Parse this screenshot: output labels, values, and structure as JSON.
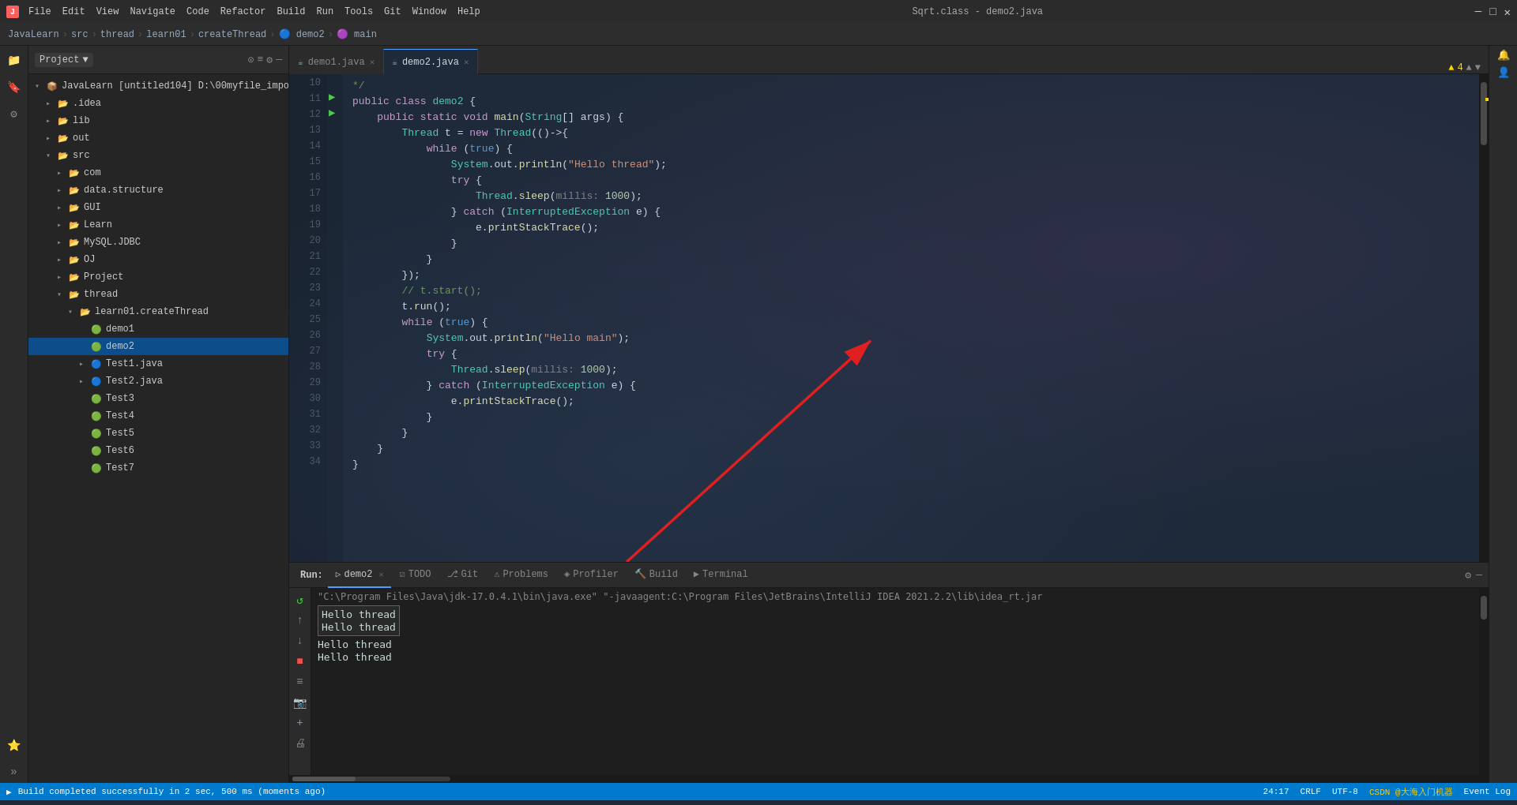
{
  "titlebar": {
    "app_icon": "J",
    "menu_items": [
      "File",
      "Edit",
      "View",
      "Navigate",
      "Code",
      "Refactor",
      "Build",
      "Run",
      "Tools",
      "Git",
      "Window",
      "Help"
    ],
    "title": "Sqrt.class - demo2.java",
    "controls": [
      "─",
      "□",
      "✕"
    ]
  },
  "breadcrumb": {
    "items": [
      "JavaLearn",
      "src",
      "thread",
      "learn01",
      "createThread",
      "demo2",
      "main"
    ]
  },
  "project_panel": {
    "title": "Project",
    "tree": [
      {
        "label": "JavaLearn [untitled104]",
        "indent": 0,
        "type": "root",
        "expanded": true
      },
      {
        "label": ".idea",
        "indent": 1,
        "type": "folder",
        "expanded": false
      },
      {
        "label": "lib",
        "indent": 1,
        "type": "folder",
        "expanded": false
      },
      {
        "label": "out",
        "indent": 1,
        "type": "folder-orange",
        "expanded": false
      },
      {
        "label": "src",
        "indent": 1,
        "type": "folder-src",
        "expanded": true
      },
      {
        "label": "com",
        "indent": 2,
        "type": "folder",
        "expanded": false
      },
      {
        "label": "data.structure",
        "indent": 2,
        "type": "folder",
        "expanded": false
      },
      {
        "label": "GUI",
        "indent": 2,
        "type": "folder",
        "expanded": false
      },
      {
        "label": "Learn",
        "indent": 2,
        "type": "folder",
        "expanded": false
      },
      {
        "label": "MySQL.JDBC",
        "indent": 2,
        "type": "folder",
        "expanded": false
      },
      {
        "label": "OJ",
        "indent": 2,
        "type": "folder",
        "expanded": false
      },
      {
        "label": "Project",
        "indent": 2,
        "type": "folder",
        "expanded": false
      },
      {
        "label": "thread",
        "indent": 2,
        "type": "folder",
        "expanded": true
      },
      {
        "label": "learn01.createThread",
        "indent": 3,
        "type": "folder",
        "expanded": true
      },
      {
        "label": "demo1",
        "indent": 4,
        "type": "java-green",
        "expanded": false
      },
      {
        "label": "demo2",
        "indent": 4,
        "type": "java-green",
        "expanded": false,
        "selected": true
      },
      {
        "label": "Test1.java",
        "indent": 4,
        "type": "java-blue",
        "expanded": false,
        "has_arrow": true
      },
      {
        "label": "Test2.java",
        "indent": 4,
        "type": "java-blue",
        "expanded": false,
        "has_arrow": true
      },
      {
        "label": "Test3",
        "indent": 4,
        "type": "java-green",
        "expanded": false
      },
      {
        "label": "Test4",
        "indent": 4,
        "type": "java-green",
        "expanded": false
      },
      {
        "label": "Test5",
        "indent": 4,
        "type": "java-green",
        "expanded": false
      },
      {
        "label": "Test6",
        "indent": 4,
        "type": "java-green",
        "expanded": false
      },
      {
        "label": "Test7",
        "indent": 4,
        "type": "java-green",
        "expanded": false
      }
    ]
  },
  "editor": {
    "tabs": [
      {
        "label": "demo1.java",
        "active": false,
        "modified": false
      },
      {
        "label": "demo2.java",
        "active": true,
        "modified": false
      }
    ],
    "lines": [
      {
        "num": 10,
        "code": "*/"
      },
      {
        "num": 11,
        "code": "public class demo2 {"
      },
      {
        "num": 12,
        "code": "    public static void main(String[] args) {"
      },
      {
        "num": 13,
        "code": "        Thread t = new Thread(()->{​"
      },
      {
        "num": 14,
        "code": "            while (true) {"
      },
      {
        "num": 15,
        "code": "                System.out.println(\"Hello thread\");"
      },
      {
        "num": 16,
        "code": "                try {"
      },
      {
        "num": 17,
        "code": "                    Thread.sleep( millis: 1000);"
      },
      {
        "num": 18,
        "code": "                } catch (InterruptedException e) {"
      },
      {
        "num": 19,
        "code": "                    e.printStackTrace();"
      },
      {
        "num": 20,
        "code": "                }"
      },
      {
        "num": 21,
        "code": "            }"
      },
      {
        "num": 22,
        "code": "        });"
      },
      {
        "num": 23,
        "code": "        // t.start();"
      },
      {
        "num": 24,
        "code": "        t.run();"
      },
      {
        "num": 25,
        "code": "        while (true) {"
      },
      {
        "num": 26,
        "code": "            System.out.println(\"Hello main\");"
      },
      {
        "num": 27,
        "code": "            try {"
      },
      {
        "num": 28,
        "code": "                Thread.sleep( millis: 1000);"
      },
      {
        "num": 29,
        "code": "            } catch (InterruptedException e) {"
      },
      {
        "num": 30,
        "code": "                e.printStackTrace();"
      },
      {
        "num": 31,
        "code": "            }"
      },
      {
        "num": 32,
        "code": "        }"
      },
      {
        "num": 33,
        "code": "    }"
      },
      {
        "num": 34,
        "code": "}"
      }
    ]
  },
  "run_panel": {
    "tab_label": "demo2",
    "cmd": "\"C:\\Program Files\\Java\\jdk-17.0.4.1\\bin\\java.exe\" \"-javaagent:C:\\Program Files\\JetBrains\\IntelliJ IDEA 2021.2.2\\lib\\idea_rt.jar",
    "outputs": [
      {
        "text": "Hello thread",
        "highlighted": true
      },
      {
        "text": "Hello thread",
        "highlighted": true
      },
      {
        "text": "Hello thread",
        "highlighted": false
      },
      {
        "text": "Hello thread",
        "highlighted": false
      }
    ]
  },
  "bottom_tabs": [
    {
      "label": "TODO",
      "icon": "☑"
    },
    {
      "label": "Git",
      "icon": "⎇"
    },
    {
      "label": "Problems",
      "icon": "⚠"
    },
    {
      "label": "Profiler",
      "icon": "📊"
    },
    {
      "label": "Build",
      "icon": "🔨"
    },
    {
      "label": "Terminal",
      "icon": "▶"
    }
  ],
  "statusbar": {
    "left": [
      "Build completed successfully in 2 sec, 500 ms (moments ago)"
    ],
    "right": [
      "24:17",
      "CRLF",
      "UTF-8",
      "Event Log"
    ]
  },
  "annotations": {
    "warning_count": "▲ 4",
    "run_tab": "Run:"
  }
}
